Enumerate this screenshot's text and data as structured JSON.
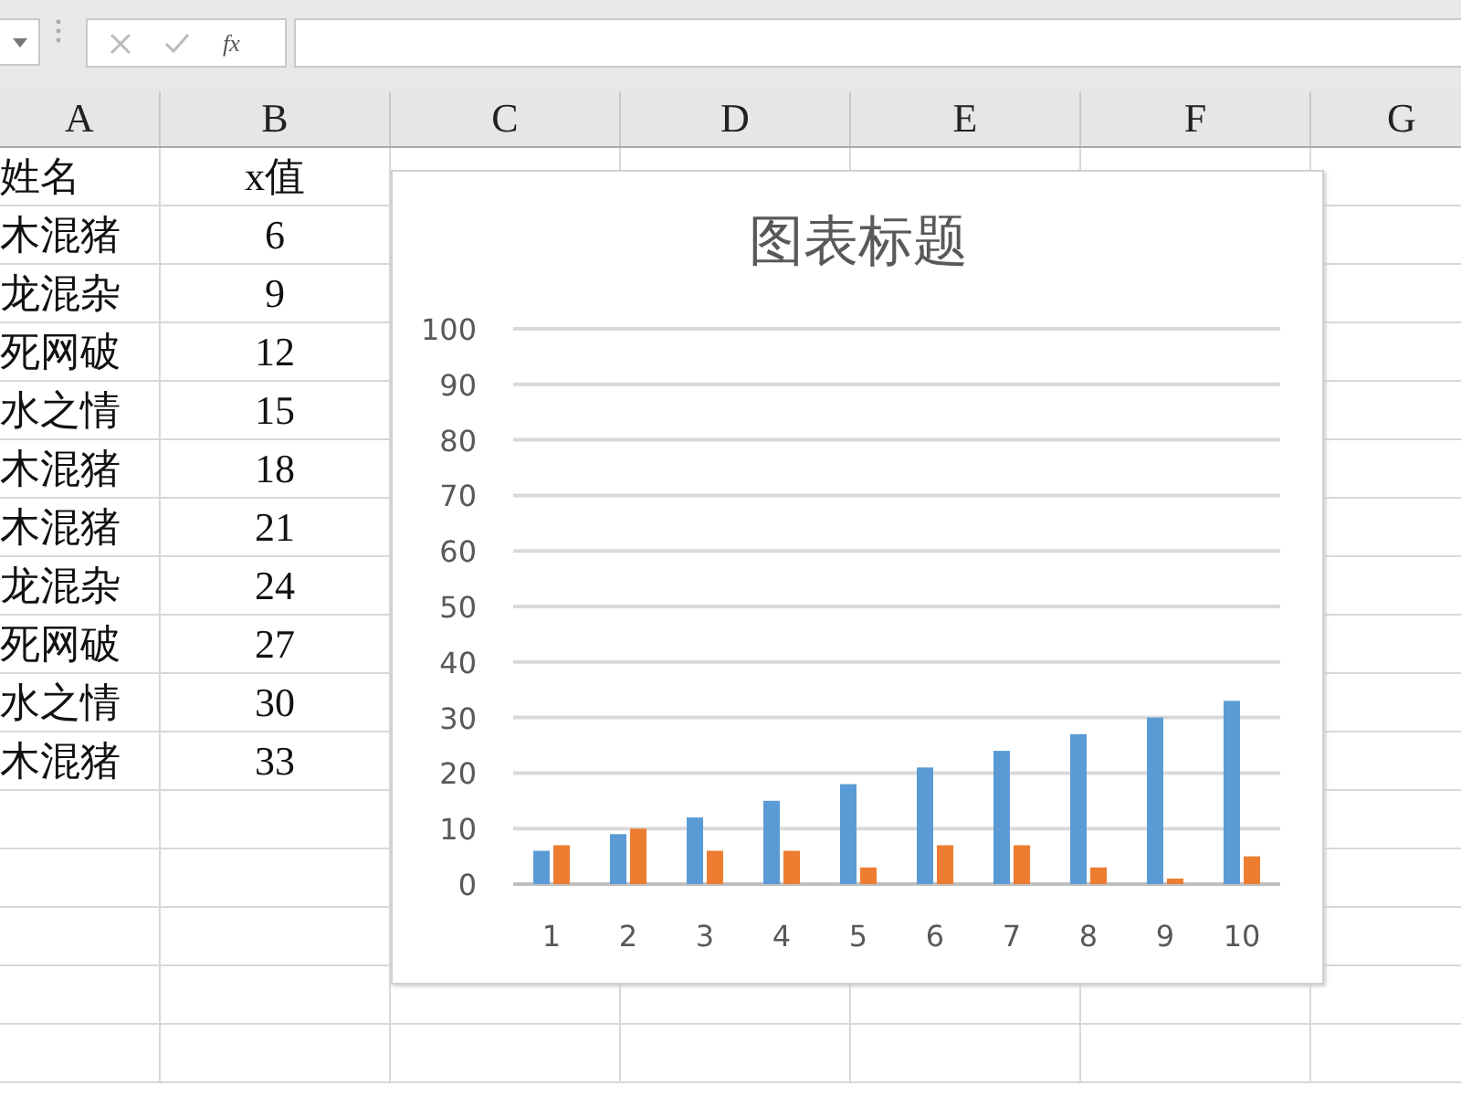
{
  "formula_bar": {
    "fx_label": "fx"
  },
  "columns": [
    "A",
    "B",
    "C",
    "D",
    "E",
    "F",
    "G"
  ],
  "rows": [
    [
      "姓名",
      "x值"
    ],
    [
      "木混猪",
      "6"
    ],
    [
      "龙混杂",
      "9"
    ],
    [
      "死网破",
      "12"
    ],
    [
      "水之情",
      "15"
    ],
    [
      "木混猪",
      "18"
    ],
    [
      "木混猪",
      "21"
    ],
    [
      "龙混杂",
      "24"
    ],
    [
      "死网破",
      "27"
    ],
    [
      "水之情",
      "30"
    ],
    [
      "木混猪",
      "33"
    ]
  ],
  "chart": {
    "chart_data": {
      "type": "bar",
      "title": "图表标题",
      "categories": [
        "1",
        "2",
        "3",
        "4",
        "5",
        "6",
        "7",
        "8",
        "9",
        "10"
      ],
      "series": [
        {
          "color": "#5b9bd5",
          "values": [
            6,
            9,
            12,
            15,
            18,
            21,
            24,
            27,
            30,
            33
          ]
        },
        {
          "color": "#ed7d31",
          "values": [
            7,
            10,
            6,
            6,
            3,
            7,
            7,
            3,
            1,
            5
          ]
        }
      ],
      "grid": true,
      "ylim": [
        0,
        100
      ],
      "yticks": [
        0,
        10,
        20,
        30,
        40,
        50,
        60,
        70,
        80,
        90,
        100
      ]
    }
  }
}
